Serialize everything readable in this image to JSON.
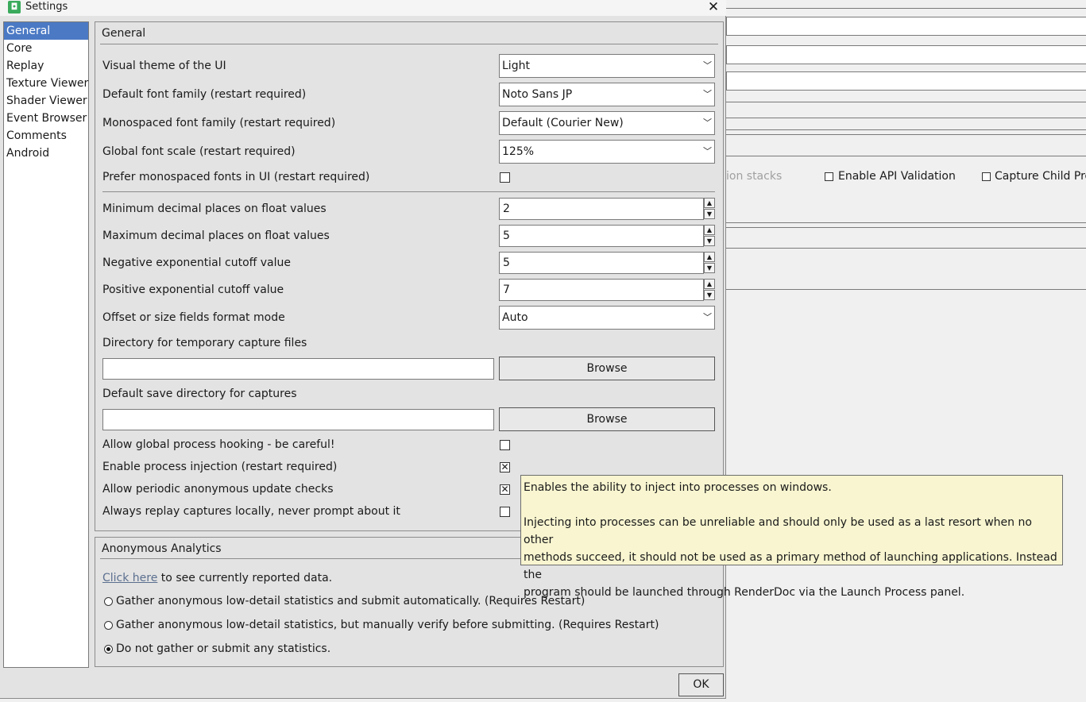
{
  "window": {
    "title": "Settings",
    "close_icon": "close-icon"
  },
  "background": {
    "faded_text": "ion stacks",
    "enable_api_validation": "Enable API Validation",
    "capture_child_processes": "Capture Child Pro"
  },
  "sidebar": {
    "items": [
      {
        "label": "General",
        "active": true
      },
      {
        "label": "Core"
      },
      {
        "label": "Replay"
      },
      {
        "label": "Texture Viewer"
      },
      {
        "label": "Shader Viewer"
      },
      {
        "label": "Event Browser"
      },
      {
        "label": "Comments"
      },
      {
        "label": "Android"
      }
    ]
  },
  "general": {
    "title": "General",
    "theme_label": "Visual theme of the UI",
    "theme_value": "Light",
    "font_label": "Default font family (restart required)",
    "font_value": "Noto Sans JP",
    "mono_label": "Monospaced font family (restart required)",
    "mono_value": "Default (Courier New)",
    "scale_label": "Global font scale (restart required)",
    "scale_value": "125%",
    "prefer_mono_label": "Prefer monospaced fonts in UI (restart required)",
    "prefer_mono_checked": false,
    "min_decimal_label": "Minimum decimal places on float values",
    "min_decimal_value": "2",
    "max_decimal_label": "Maximum decimal places on float values",
    "max_decimal_value": "5",
    "neg_exp_label": "Negative exponential cutoff value",
    "neg_exp_value": "5",
    "pos_exp_label": "Positive exponential cutoff value",
    "pos_exp_value": "7",
    "offset_label": "Offset or size fields format mode",
    "offset_value": "Auto",
    "temp_dir_label": "Directory for temporary capture files",
    "temp_dir_value": "",
    "save_dir_label": "Default save directory for captures",
    "save_dir_value": "",
    "browse_label": "Browse",
    "global_hook_label": "Allow global process hooking - be careful!",
    "global_hook_checked": false,
    "injection_label": "Enable process injection (restart required)",
    "injection_checked": true,
    "update_checks_label": "Allow periodic anonymous update checks",
    "update_checks_checked": true,
    "replay_local_label": "Always replay captures locally, never prompt about it",
    "replay_local_checked": false
  },
  "analytics": {
    "title": "Anonymous Analytics",
    "link_text": "Click here",
    "link_suffix": " to see currently reported data.",
    "options": [
      {
        "label": "Gather anonymous low-detail statistics and submit automatically. (Requires Restart)",
        "selected": false
      },
      {
        "label": "Gather anonymous low-detail statistics, but manually verify before submitting. (Requires Restart)",
        "selected": false
      },
      {
        "label": "Do not gather or submit any statistics.",
        "selected": true
      }
    ]
  },
  "ok_label": "OK",
  "tooltip": {
    "line1": "Enables the ability to inject into processes on windows.",
    "line2": "Injecting into processes can be unreliable and should only be used as a last resort when no other",
    "line3": "methods succeed, it should not be used as a primary method of launching applications. Instead the",
    "line4": "program should be launched through RenderDoc via the Launch Process panel."
  }
}
